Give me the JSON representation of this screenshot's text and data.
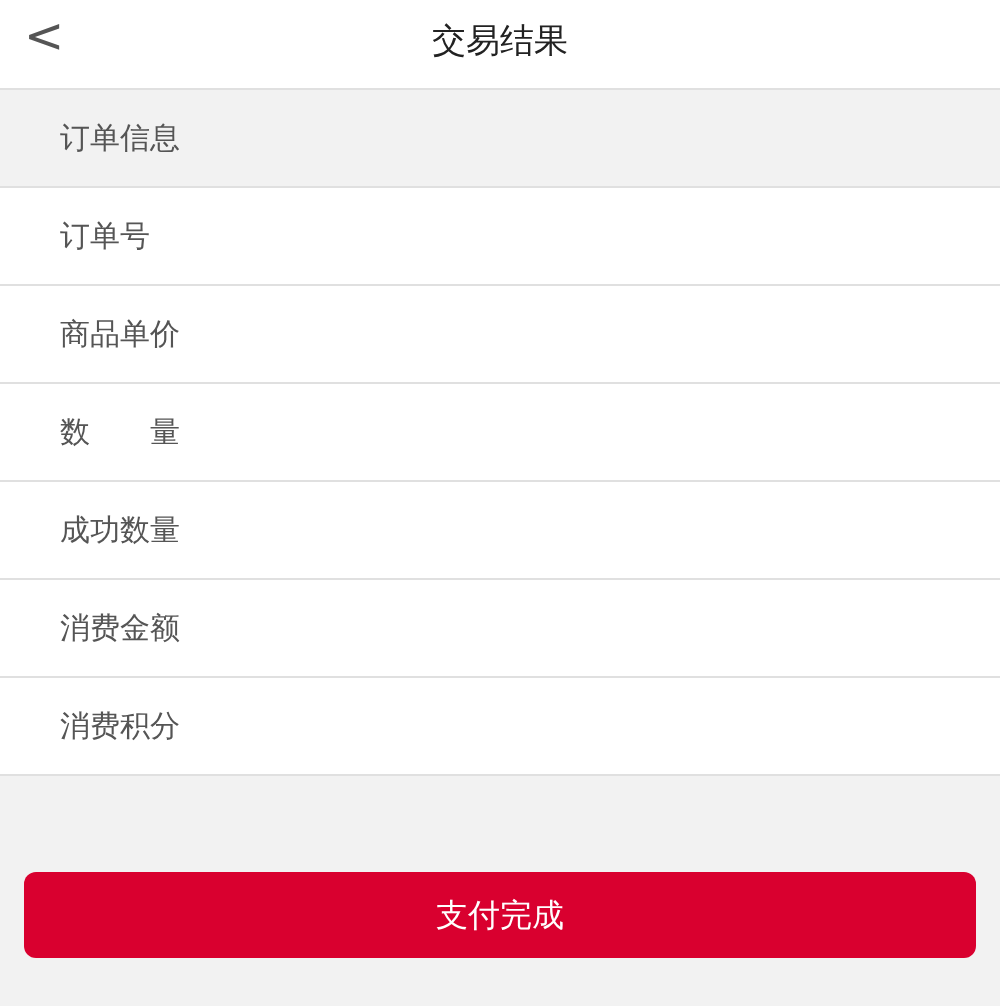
{
  "header": {
    "back": "<",
    "title": "交易结果"
  },
  "section": {
    "title": "订单信息"
  },
  "rows": [
    {
      "label": "订单号"
    },
    {
      "label": "商品单价"
    },
    {
      "label": "数　　量"
    },
    {
      "label": "成功数量"
    },
    {
      "label": "消费金额"
    },
    {
      "label": "消费积分"
    }
  ],
  "button": {
    "label": "支付完成"
  }
}
